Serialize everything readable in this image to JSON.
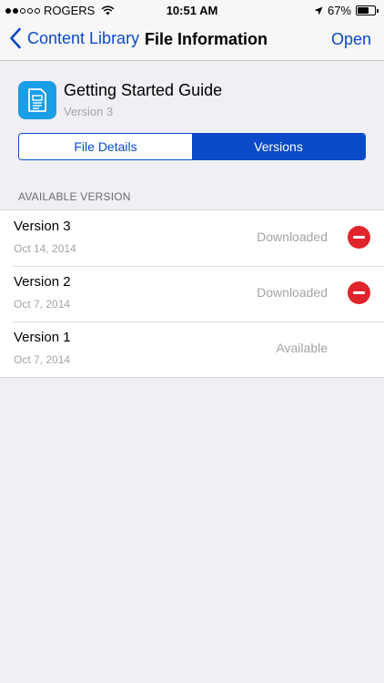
{
  "status_bar": {
    "carrier": "ROGERS",
    "time": "10:51 AM",
    "battery": "67%",
    "battery_level": 0.67
  },
  "nav": {
    "back_label": "Content Library",
    "title": "File Information",
    "action_label": "Open"
  },
  "file": {
    "title": "Getting Started Guide",
    "subtitle": "Version 3"
  },
  "segments": {
    "details_label": "File Details",
    "versions_label": "Versions",
    "selected": "Versions"
  },
  "section_header": "AVAILABLE VERSION",
  "versions": [
    {
      "title": "Version 3",
      "date": "Oct 14, 2014",
      "status": "Downloaded",
      "deletable": true
    },
    {
      "title": "Version 2",
      "date": "Oct 7, 2014",
      "status": "Downloaded",
      "deletable": true
    },
    {
      "title": "Version 1",
      "date": "Oct 7, 2014",
      "status": "Available",
      "deletable": false
    }
  ],
  "colors": {
    "accent": "#0a49c8",
    "delete": "#e0242c",
    "file_icon": "#1a9ee6"
  }
}
